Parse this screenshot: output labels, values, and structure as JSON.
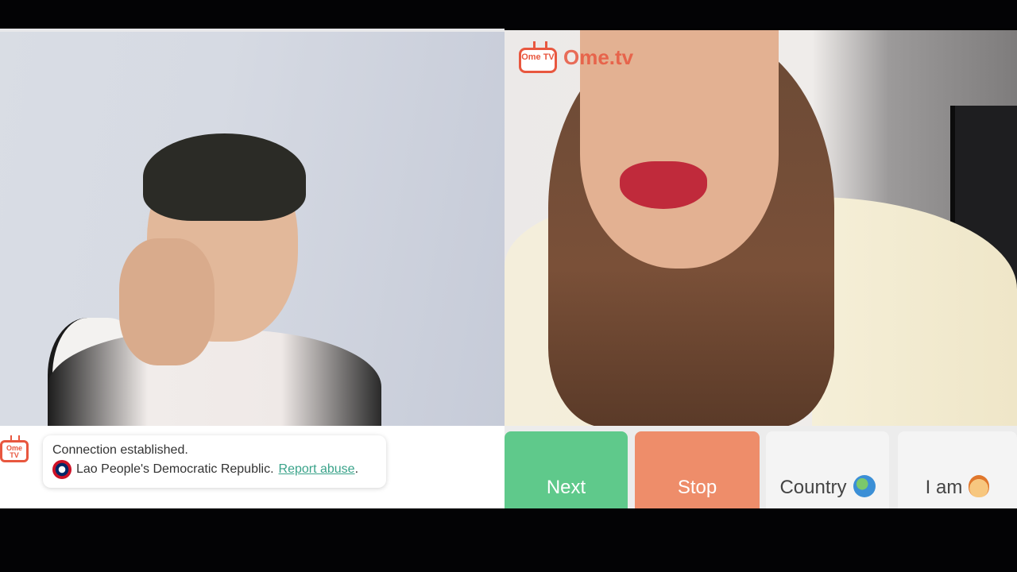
{
  "watermark": {
    "logo_text": "Ome TV",
    "brand": "Ome.tv"
  },
  "chat": {
    "logo_text": "Ome TV",
    "status": "Connection established.",
    "country": "Lao People's Democratic Republic.",
    "report_link": "Report abuse",
    "report_suffix": ".",
    "flag_icon": "laos-flag-icon"
  },
  "controls": {
    "next_label": "Next",
    "stop_label": "Stop",
    "country_label": "Country",
    "country_icon": "globe-icon",
    "iam_label": "I am",
    "iam_icon": "person-icon",
    "colors": {
      "next": "#5fc98b",
      "stop": "#ee8d6a",
      "neutral": "#f4f4f4",
      "link": "#3aa38a",
      "brand": "#e8573f"
    }
  }
}
